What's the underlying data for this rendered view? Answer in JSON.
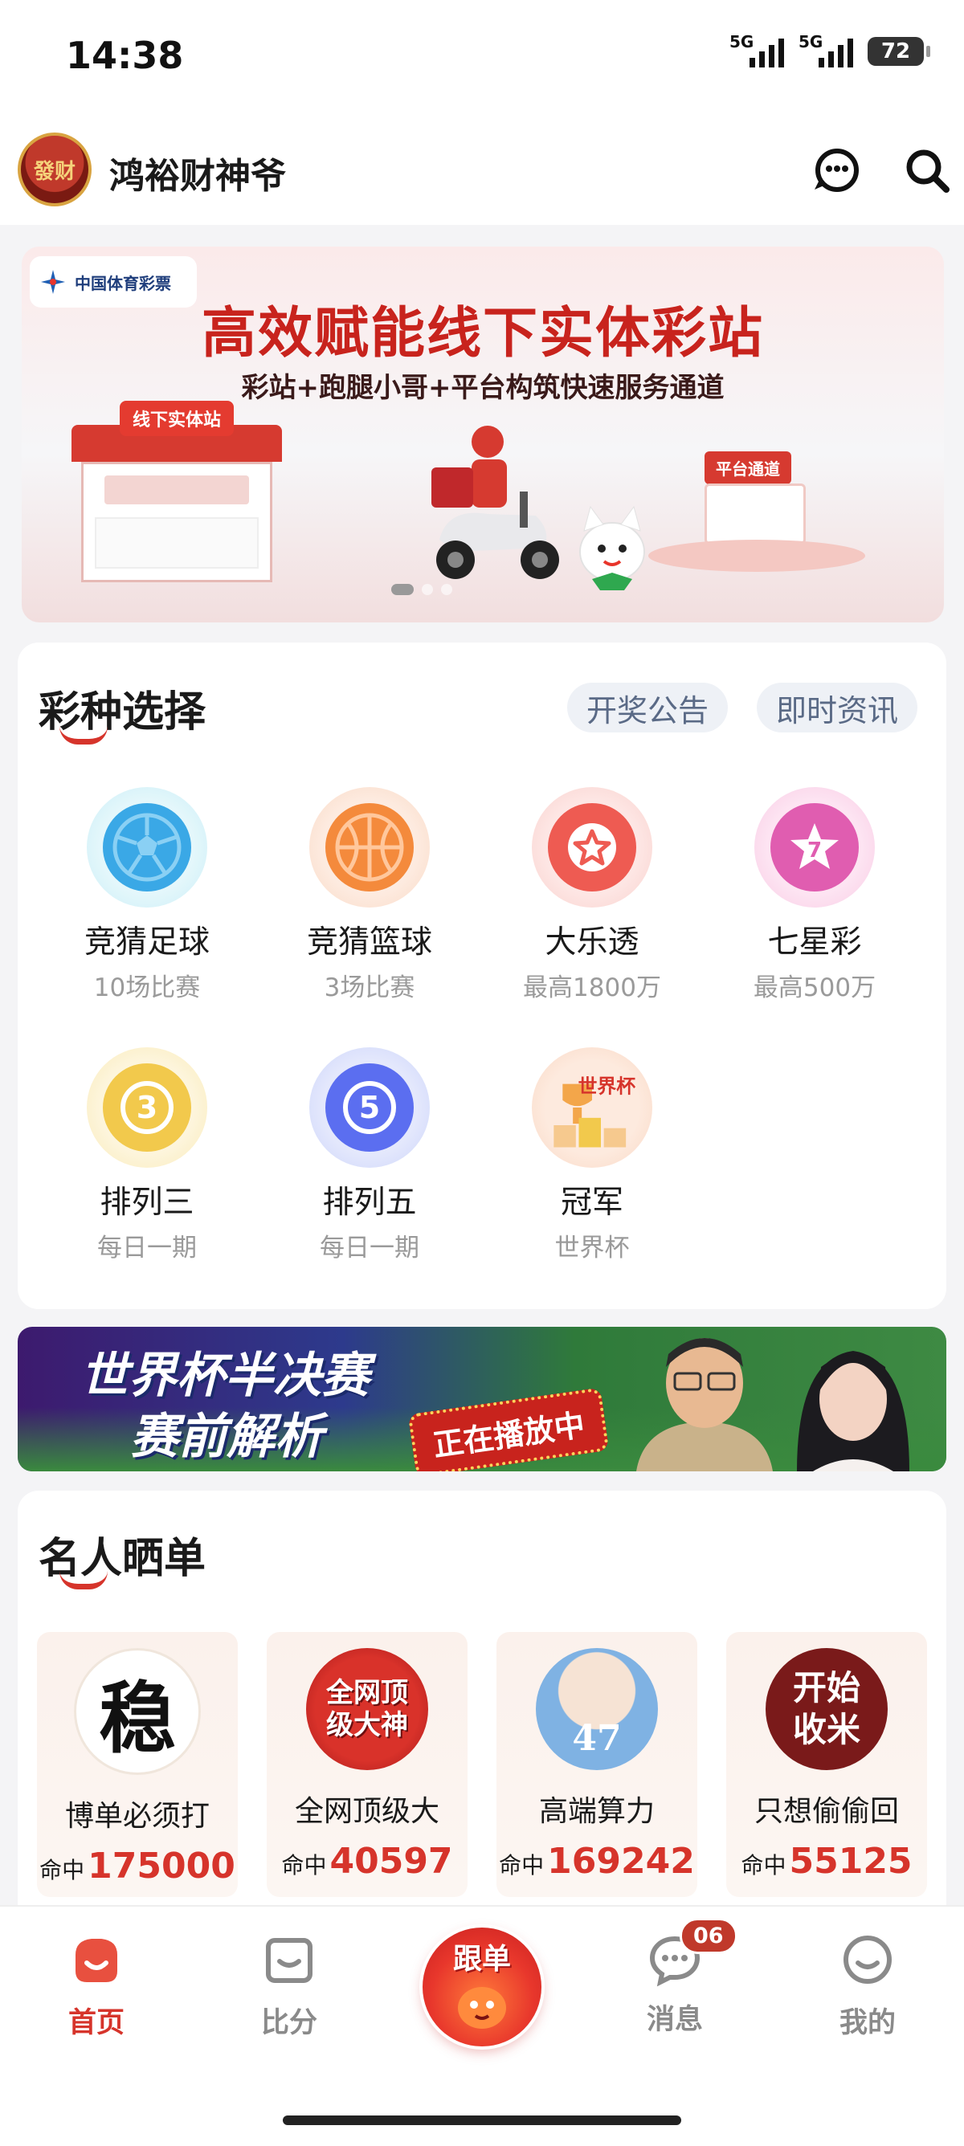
{
  "status_bar": {
    "time": "14:38",
    "signal1": "5G",
    "signal2": "5G",
    "battery": "72"
  },
  "header": {
    "app_title": "鸿裕财神爷",
    "avatar_text": "發财"
  },
  "banner": {
    "logo_text": "中国体育彩票",
    "title": "高效赋能线下实体彩站",
    "subtitle": "彩站+跑腿小哥+平台构筑快速服务通道",
    "booth_sign": "线下实体站",
    "platform_sign": "平台通道"
  },
  "lottery": {
    "title": "彩种选择",
    "chips": [
      "开奖公告",
      "即时资讯"
    ],
    "games": [
      {
        "name": "竞猜足球",
        "sub": "10场比赛",
        "icon": "football-icon"
      },
      {
        "name": "竞猜篮球",
        "sub": "3场比赛",
        "icon": "basketball-icon"
      },
      {
        "name": "大乐透",
        "sub": "最高1800万",
        "icon": "star-ball-icon"
      },
      {
        "name": "七星彩",
        "sub": "最高500万",
        "icon": "seven-star-icon"
      },
      {
        "name": "排列三",
        "sub": "每日一期",
        "icon": "number-three-icon",
        "num": "3"
      },
      {
        "name": "排列五",
        "sub": "每日一期",
        "icon": "number-five-icon",
        "num": "5"
      },
      {
        "name": "冠军",
        "sub": "世界杯",
        "icon": "world-cup-trophy-icon",
        "num": "世界杯"
      }
    ]
  },
  "promo": {
    "line1": "世界杯半决赛",
    "line2": "赛前解析",
    "live": "正在播放中"
  },
  "celebrities": {
    "title": "名人晒单",
    "hit_label": "命中",
    "items": [
      {
        "name": "博单必须打",
        "hits": "175000",
        "avatar_text": "稳"
      },
      {
        "name": "全网顶级大",
        "hits": "40597",
        "avatar_text": "全网顶级大神"
      },
      {
        "name": "高端算力",
        "hits": "169242",
        "avatar_text": "47"
      },
      {
        "name": "只想偷偷回",
        "hits": "55125",
        "avatar_text": "开始收米"
      }
    ]
  },
  "nav": {
    "home": "首页",
    "score": "比分",
    "follow": "跟单",
    "messages": "消息",
    "messages_badge": "06",
    "me": "我的"
  },
  "colors": {
    "accent": "#d6342b",
    "chip_text": "#5a6a86"
  }
}
